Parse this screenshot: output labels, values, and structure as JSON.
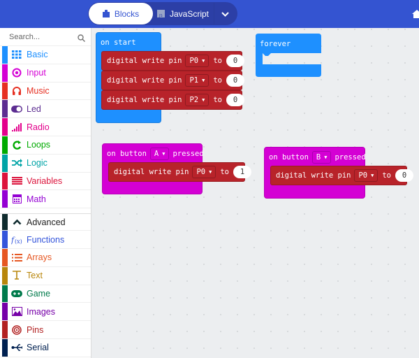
{
  "header": {
    "tabs": [
      {
        "label": "Blocks",
        "icon": "puzzle-icon",
        "active": true
      },
      {
        "label": "JavaScript",
        "icon": "js-icon",
        "active": false
      }
    ],
    "more_icon": "chevron-down-icon",
    "home_icon": "home-icon",
    "colors": {
      "bar": "#3454d1",
      "toggle": "#2c3fa6"
    }
  },
  "sidebar": {
    "search_placeholder": "Search...",
    "categories": [
      {
        "label": "Basic",
        "icon": "grid-icon",
        "color": "#1e90ff"
      },
      {
        "label": "Input",
        "icon": "target-icon",
        "color": "#d400d4"
      },
      {
        "label": "Music",
        "icon": "headphones-icon",
        "color": "#e63022"
      },
      {
        "label": "Led",
        "icon": "toggle-icon",
        "color": "#5c2d91"
      },
      {
        "label": "Radio",
        "icon": "signal-bars-icon",
        "color": "#e3008c"
      },
      {
        "label": "Loops",
        "icon": "loop-arrow-icon",
        "color": "#00aa00"
      },
      {
        "label": "Logic",
        "icon": "shuffle-icon",
        "color": "#00a4a6"
      },
      {
        "label": "Variables",
        "icon": "list-lines-icon",
        "color": "#dc143c"
      },
      {
        "label": "Math",
        "icon": "calculator-icon",
        "color": "#9400d3"
      }
    ],
    "advanced": {
      "label": "Advanced",
      "icon": "chevron-up-icon",
      "color": "#0f2b2e"
    },
    "advanced_categories": [
      {
        "label": "Functions",
        "icon": "function-icon",
        "color": "#3455db"
      },
      {
        "label": "Arrays",
        "icon": "numbered-list-icon",
        "color": "#e65722"
      },
      {
        "label": "Text",
        "icon": "text-icon",
        "color": "#b8860b"
      },
      {
        "label": "Game",
        "icon": "gamepad-icon",
        "color": "#007a4b"
      },
      {
        "label": "Images",
        "icon": "image-icon",
        "color": "#7600a8"
      },
      {
        "label": "Pins",
        "icon": "pins-target-icon",
        "color": "#b22222"
      },
      {
        "label": "Serial",
        "icon": "usb-icon",
        "color": "#002050"
      }
    ]
  },
  "workspace": {
    "colors": {
      "event_blue": "#1e90ff",
      "input_magenta": "#d400d4",
      "pins_red": "#b8232a"
    },
    "on_start": {
      "title": "on start",
      "statements": [
        {
          "text": "digital write pin",
          "pin": "P0",
          "to": "to",
          "value": "0"
        },
        {
          "text": "digital write pin",
          "pin": "P1",
          "to": "to",
          "value": "0"
        },
        {
          "text": "digital write pin",
          "pin": "P2",
          "to": "to",
          "value": "0"
        }
      ]
    },
    "forever": {
      "title": "forever"
    },
    "button_a": {
      "prefix": "on button",
      "button": "A",
      "suffix": "pressed",
      "statement": {
        "text": "digital write pin",
        "pin": "P0",
        "to": "to",
        "value": "1"
      }
    },
    "button_b": {
      "prefix": "on button",
      "button": "B",
      "suffix": "pressed",
      "statement": {
        "text": "digital write pin",
        "pin": "P0",
        "to": "to",
        "value": "0"
      }
    }
  }
}
